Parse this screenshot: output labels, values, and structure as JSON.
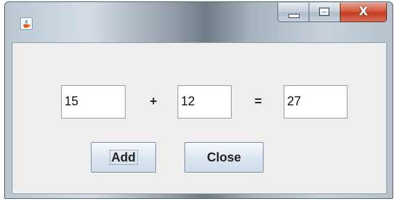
{
  "window": {
    "icon": "java-coffee-cup-icon",
    "caption_buttons": {
      "minimize": "minimize-icon",
      "maximize": "maximize-icon",
      "close_glyph": "X"
    }
  },
  "calculator": {
    "operand1": "15",
    "operator": "+",
    "operand2": "12",
    "equals": "=",
    "result": "27"
  },
  "buttons": {
    "add_label": "Add",
    "close_label": "Close"
  },
  "colors": {
    "content_bg": "#eeeeee",
    "close_button": "#c94a2e",
    "button_border": "#7a8ea3"
  }
}
